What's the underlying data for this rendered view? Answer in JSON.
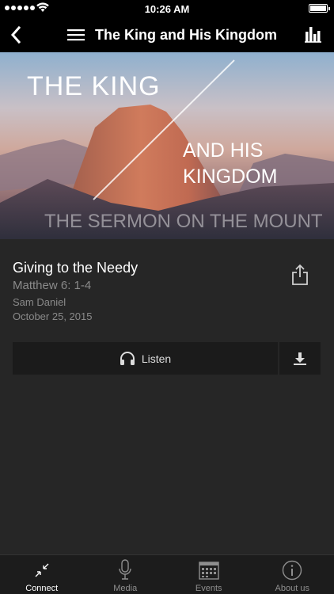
{
  "status_bar": {
    "time": "10:26 AM"
  },
  "nav": {
    "title": "The King and His Kingdom",
    "icons": [
      "back-chevron-icon",
      "hamburger-menu-icon",
      "bar-chart-icon"
    ]
  },
  "hero": {
    "title_line1": "THE KING",
    "title_line2": "AND HIS KINGDOM",
    "subtitle": "THE SERMON ON THE MOUNT"
  },
  "sermon": {
    "title": "Giving to the Needy",
    "scripture": "Matthew 6: 1-4",
    "speaker": "Sam Daniel",
    "date": "October 25, 2015"
  },
  "actions": {
    "listen_label": "Listen",
    "listen_icon": "headphones-icon",
    "download_icon": "download-icon",
    "share_icon": "share-icon"
  },
  "tabs": [
    {
      "label": "Connect",
      "icon": "connect-icon",
      "active": true
    },
    {
      "label": "Media",
      "icon": "microphone-icon",
      "active": false
    },
    {
      "label": "Events",
      "icon": "calendar-icon",
      "active": false
    },
    {
      "label": "About us",
      "icon": "info-icon",
      "active": false
    }
  ],
  "colors": {
    "background": "#262626",
    "bar": "#000000",
    "button": "#1b1b1b",
    "muted_text": "#8a8a8a"
  }
}
